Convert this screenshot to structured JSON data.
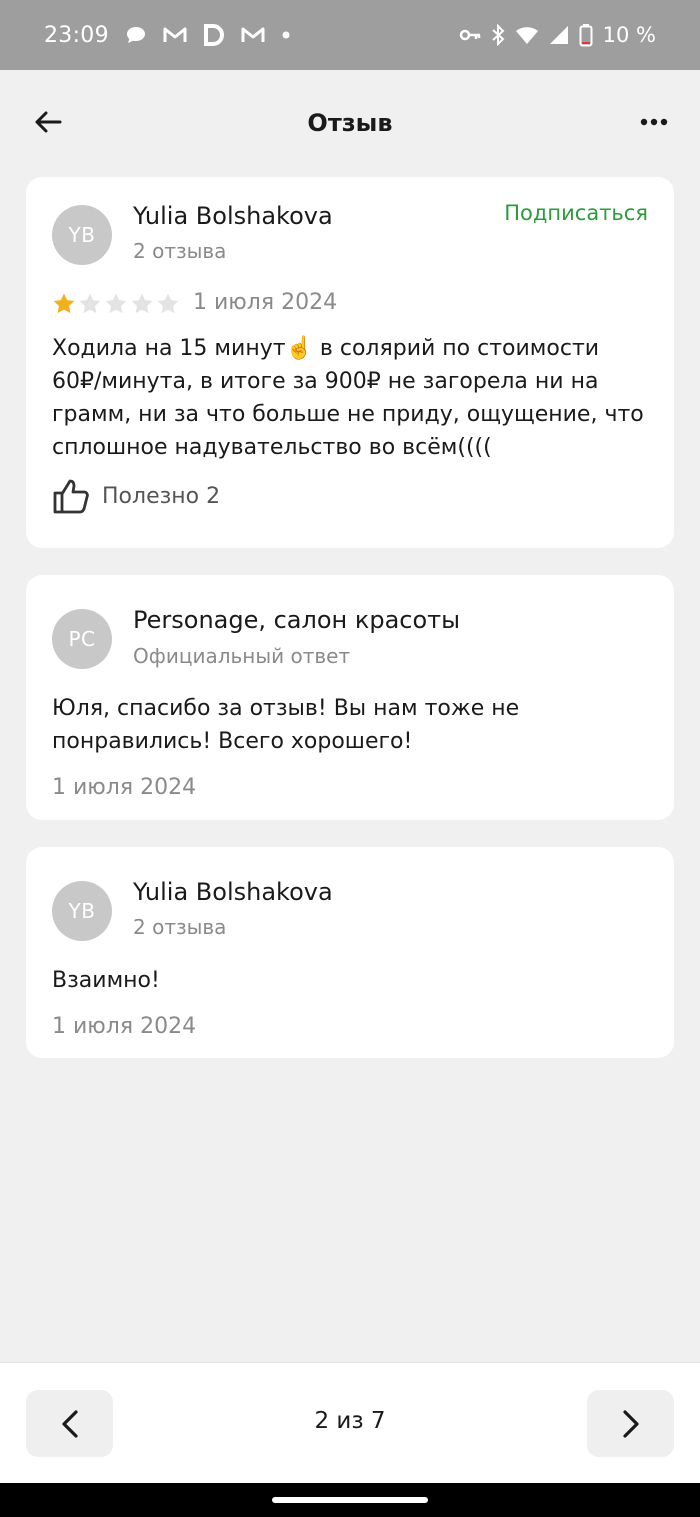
{
  "status_bar": {
    "time": "23:09",
    "notification_icons": [
      "chat-icon",
      "gmail-icon",
      "d-app-icon",
      "gmail-icon",
      "dot-icon"
    ],
    "system_icons": [
      "key-icon",
      "bluetooth-icon",
      "wifi-icon",
      "signal-icon",
      "battery-icon"
    ],
    "battery_text": "10 %",
    "battery_level": 0.1
  },
  "app_bar": {
    "title": "Отзыв"
  },
  "review": {
    "avatar_initials": "YB",
    "author": "Yulia Bolshakova",
    "author_reviews": "2 отзыва",
    "subscribe_label": "Подписаться",
    "rating": 1,
    "rating_max": 5,
    "date": "1 июля 2024",
    "text": "Ходила на 15 минут☝️  в солярий по стоимости 60₽/минута, в итоге за 900₽ не загорела ни на грамм, ни за что больше не приду, ощущение, что сплошное надувательство во всём((((",
    "helpful_label": "Полезно 2"
  },
  "official_reply": {
    "avatar_initials": "PC",
    "author": "Personage, салон красоты",
    "subtitle": "Официальный ответ",
    "text": "Юля, спасибо за отзыв! Вы нам тоже не понравились! Всего хорошего!",
    "date": "1 июля 2024"
  },
  "user_reply": {
    "avatar_initials": "YB",
    "author": "Yulia Bolshakova",
    "author_reviews": "2 отзыва",
    "text": "Взаимно!",
    "date": "1 июля 2024"
  },
  "pagination": {
    "label": "2 из 7"
  },
  "colors": {
    "status_bar_bg": "#9e9e9e",
    "page_bg": "#f0f0f0",
    "card_bg": "#ffffff",
    "subscribe_green": "#2a9d3a",
    "star_filled": "#f2b01e",
    "star_empty": "#e3e3e3",
    "avatar_bg": "#c8c8c8"
  }
}
